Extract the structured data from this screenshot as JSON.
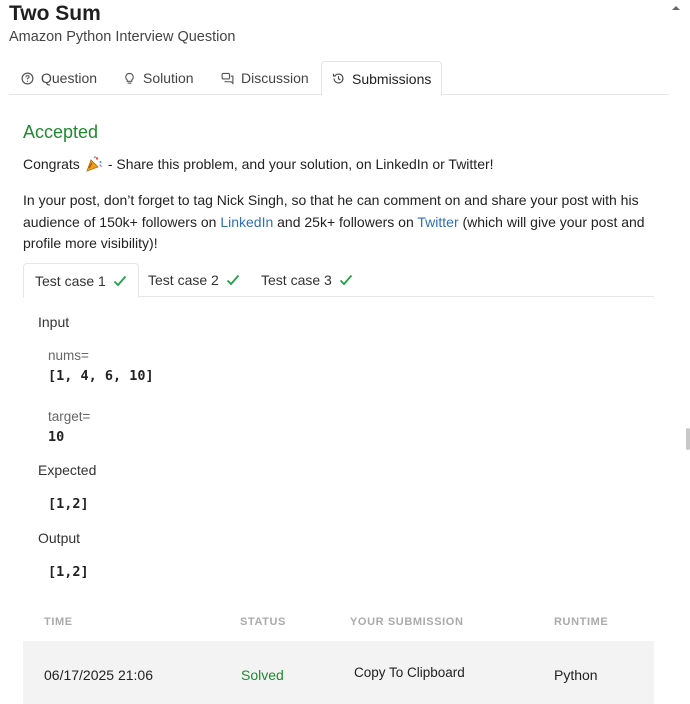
{
  "problem": {
    "title": "Two Sum",
    "subtitle": "Amazon Python Interview Question"
  },
  "tabs": [
    {
      "label": "Question",
      "icon": "question-circle-icon"
    },
    {
      "label": "Solution",
      "icon": "lightbulb-icon"
    },
    {
      "label": "Discussion",
      "icon": "chat-bubbles-icon"
    },
    {
      "label": "Submissions",
      "icon": "history-icon",
      "active": true
    }
  ],
  "result": {
    "status": "Accepted",
    "congrats_prefix": "Congrats",
    "congrats_suffix": "- Share this problem, and your solution, on LinkedIn or Twitter!",
    "para_part1": "In your post, don’t forget to tag Nick Singh, so that he can comment on and share your post with his audience of 150k+ followers on ",
    "linkedin_link": "LinkedIn",
    "para_part2": " and 25k+ followers on ",
    "twitter_link": "Twitter",
    "para_part3": " (which will give your post and profile more visibility)!"
  },
  "test_tabs": [
    {
      "label": "Test case 1",
      "active": true
    },
    {
      "label": "Test case 2"
    },
    {
      "label": "Test case 3"
    }
  ],
  "test_case": {
    "input_label": "Input",
    "nums_label": "nums=",
    "nums_value": "[1, 4, 6, 10]",
    "target_label": "target=",
    "target_value": "10",
    "expected_label": "Expected",
    "expected_value": "[1,2]",
    "output_label": "Output",
    "output_value": "[1,2]"
  },
  "submissions": {
    "headers": [
      "TIME",
      "STATUS",
      "YOUR SUBMISSION",
      "RUNTIME"
    ],
    "rows": [
      {
        "time": "06/17/2025 21:06",
        "status": "Solved",
        "submission": "Copy To Clipboard",
        "runtime": "Python"
      }
    ]
  },
  "colors": {
    "accepted": "#1f8a2e",
    "link": "#2f6fb5",
    "check": "#22a34a"
  }
}
